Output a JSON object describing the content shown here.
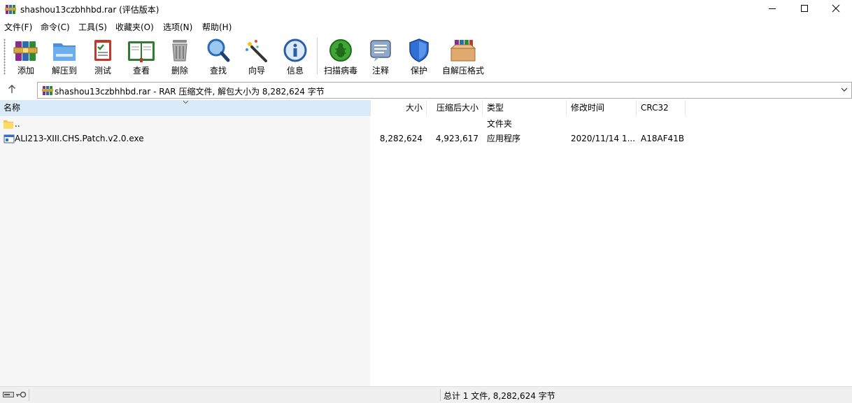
{
  "window": {
    "title": "shashou13czbhhbd.rar (评估版本)",
    "controls": {
      "minimize": "minimize-icon",
      "maximize": "maximize-icon",
      "close": "close-icon"
    }
  },
  "menu": [
    {
      "label": "文件(F)"
    },
    {
      "label": "命令(C)"
    },
    {
      "label": "工具(S)"
    },
    {
      "label": "收藏夹(O)"
    },
    {
      "label": "选项(N)"
    },
    {
      "label": "帮助(H)"
    }
  ],
  "toolbar": [
    {
      "label": "添加",
      "icon": "add-books-icon"
    },
    {
      "label": "解压到",
      "icon": "extract-folder-icon"
    },
    {
      "label": "测试",
      "icon": "test-checklist-icon"
    },
    {
      "label": "查看",
      "icon": "view-book-icon"
    },
    {
      "label": "删除",
      "icon": "trash-icon"
    },
    {
      "label": "查找",
      "icon": "magnifier-icon"
    },
    {
      "label": "向导",
      "icon": "wizard-wand-icon"
    },
    {
      "label": "信息",
      "icon": "info-icon"
    },
    {
      "label": "扫描病毒",
      "icon": "virus-scan-icon"
    },
    {
      "label": "注释",
      "icon": "comment-icon"
    },
    {
      "label": "保护",
      "icon": "shield-icon"
    },
    {
      "label": "自解压格式",
      "icon": "sfx-box-icon"
    }
  ],
  "address": {
    "text": "shashou13czbhhbd.rar - RAR 压缩文件, 解包大小为 8,282,624 字节"
  },
  "columns": {
    "name": "名称",
    "size": "大小",
    "packed": "压缩后大小",
    "type": "类型",
    "modified": "修改时间",
    "crc": "CRC32"
  },
  "rows": [
    {
      "name": "..",
      "size": "",
      "packed": "",
      "type": "文件夹",
      "modified": "",
      "crc": "",
      "icon": "folder-icon"
    },
    {
      "name": "ALI213-XIII.CHS.Patch.v2.0.exe",
      "size": "8,282,624",
      "packed": "4,923,617",
      "type": "应用程序",
      "modified": "2020/11/14 1...",
      "crc": "A18AF41B",
      "icon": "exe-file-icon"
    }
  ],
  "status": {
    "summary": "总计 1 文件, 8,282,624 字节"
  },
  "colors": {
    "sorted_column": "#d9ebf9",
    "name_column_bg": "#f7f7f7",
    "statusbar_bg": "#f0f0f0"
  }
}
